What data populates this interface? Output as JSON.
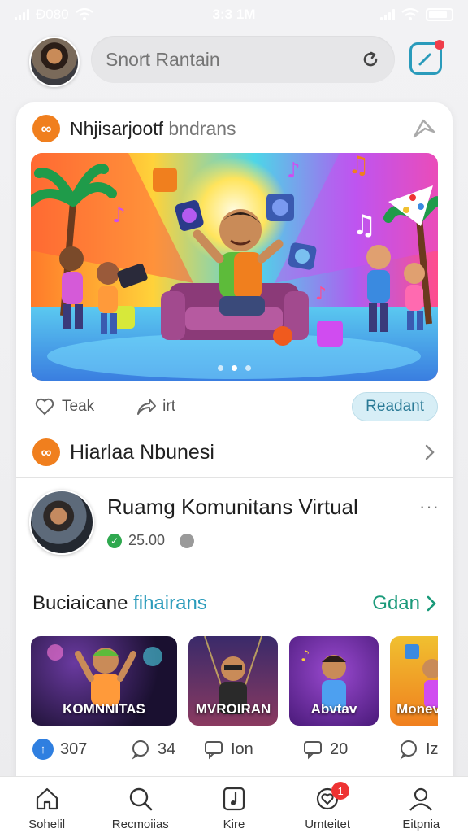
{
  "status_bar": {
    "carrier": "Ð080",
    "time": "3:3 1M"
  },
  "search": {
    "placeholder": "Snort Rantain"
  },
  "post": {
    "title_main": "Nhjisarjootf",
    "title_light": " bndrans",
    "like_label": "Teak",
    "share_label": "irt",
    "read_button": "Readant"
  },
  "section": {
    "title": "Hiarlaa Nbunesi"
  },
  "community": {
    "name": "Ruamg Komunitans Virtual",
    "count": "25.00",
    "more": "···"
  },
  "recommended": {
    "title_main": "Buciaicane ",
    "title_accent": "fihairans",
    "see_all": "Gdan",
    "tiles": [
      {
        "label": "KOMNNITAS"
      },
      {
        "label": "MVROIRAN"
      },
      {
        "label": "Abvtav"
      },
      {
        "label": "Monev"
      }
    ]
  },
  "stats": [
    {
      "value": "307",
      "icon": "upvote-icon"
    },
    {
      "value": "34",
      "icon": "chat-bubble-icon"
    },
    {
      "value": "Ion",
      "icon": "comment-icon"
    },
    {
      "value": "20",
      "icon": "comment-icon"
    },
    {
      "value": "Iz",
      "icon": "chat-bubble-icon"
    }
  ],
  "tabs": [
    {
      "label": "Sohelil",
      "icon": "home-icon"
    },
    {
      "label": "Recmoiias",
      "icon": "search-icon"
    },
    {
      "label": "Kire",
      "icon": "music-note-icon"
    },
    {
      "label": "Umteitet",
      "icon": "heart-chat-icon",
      "badge": "1"
    },
    {
      "label": "Eitpnia",
      "icon": "profile-icon"
    }
  ],
  "colors": {
    "accent": "#2a9bbb",
    "brand": "#f07f1e",
    "see_all": "#1a9a7a",
    "badge": "#e33333"
  }
}
